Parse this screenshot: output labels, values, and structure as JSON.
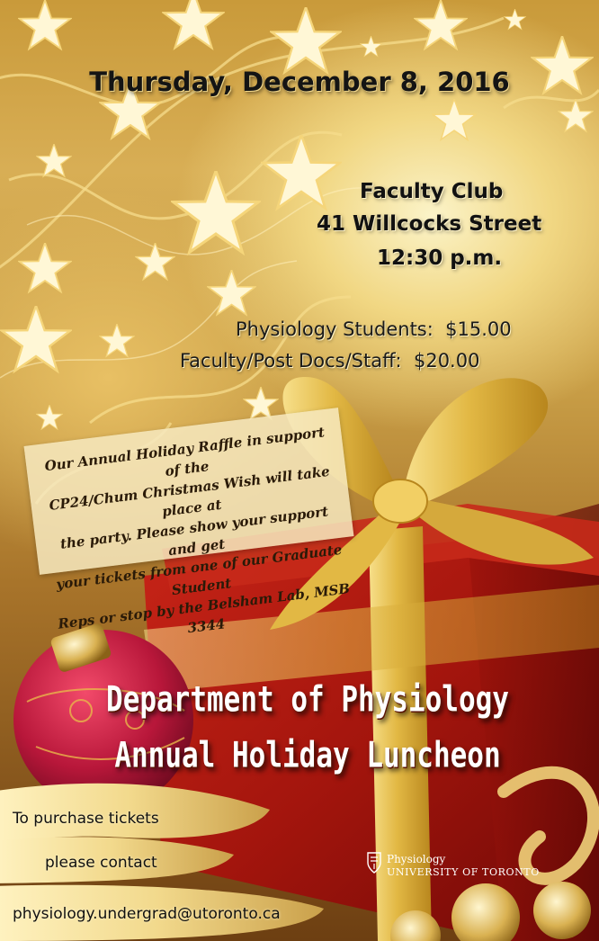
{
  "event": {
    "date": "Thursday, December 8, 2016",
    "venue_name": "Faculty Club",
    "venue_address": "41 Willcocks Street",
    "time": "12:30 p.m.",
    "title_line1": "Department of Physiology",
    "title_line2": "Annual Holiday Luncheon"
  },
  "pricing": {
    "students": "Physiology Students:  $15.00",
    "faculty": "Faculty/Post Docs/Staff:  $20.00"
  },
  "raffle": {
    "text": "Our Annual Holiday Raffle in support of the\nCP24/Chum Christmas Wish will take place at\nthe party. Please show your support and get\nyour tickets from one of our Graduate Student\nReps or stop by the Belsham Lab, MSB 3344"
  },
  "contact": {
    "line1": "To purchase tickets",
    "line2": "please contact",
    "email": "physiology.undergrad@utoronto.ca"
  },
  "logo": {
    "department": "Physiology",
    "university": "UNIVERSITY OF TORONTO"
  },
  "colors": {
    "gold": "#d8ae55",
    "gift_red": "#b01a12",
    "ribbon_gold": "#e8c14e",
    "text_dark": "#111111",
    "title_white": "#ffffff"
  }
}
